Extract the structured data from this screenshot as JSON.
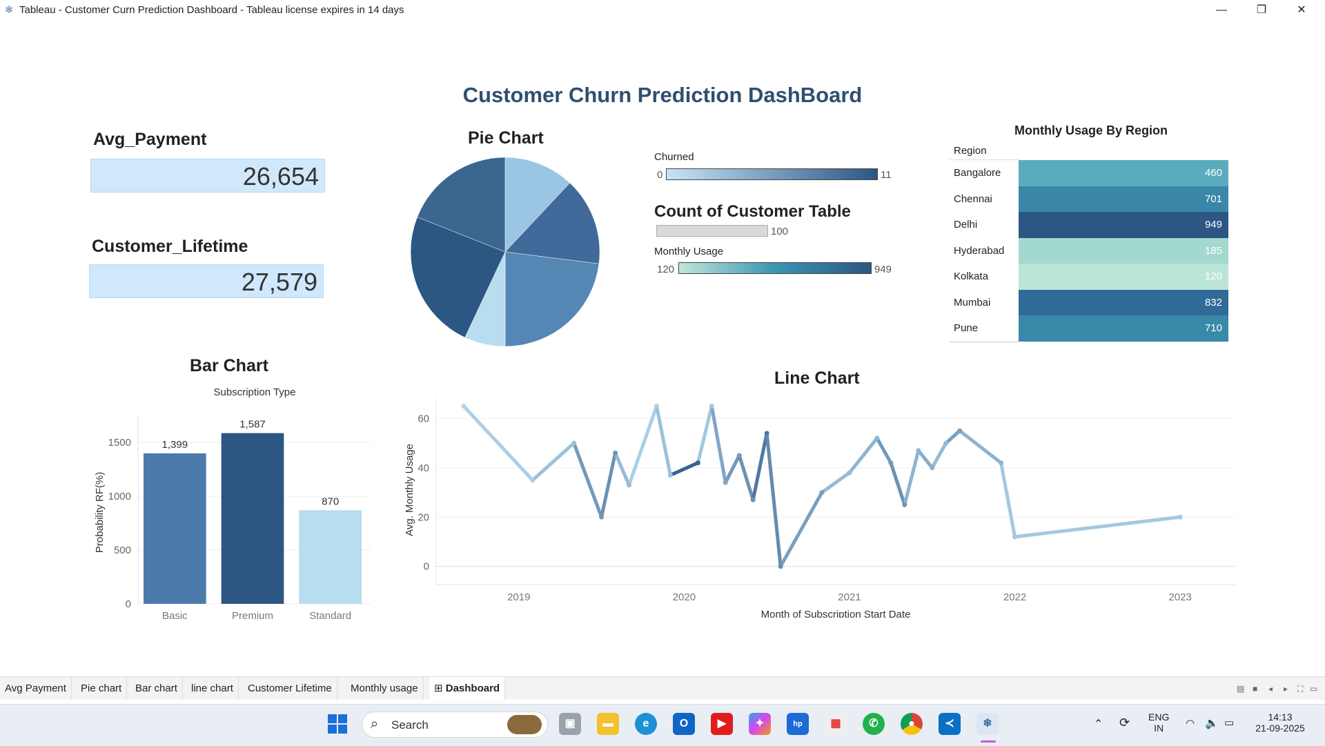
{
  "window": {
    "title": "Tableau - Customer Curn Prediction Dashboard - Tableau license expires in 14 days",
    "minimize": "—",
    "maximize": "❐",
    "close": "✕"
  },
  "dashboard": {
    "title": "Customer Churn Prediction DashBoard",
    "avg_payment": {
      "title": "Avg_Payment",
      "value": "26,654"
    },
    "customer_lifetime": {
      "title": "Customer_Lifetime",
      "value": "27,579"
    },
    "pie_title": "Pie Chart",
    "legends": {
      "churned": {
        "label": "Churned",
        "min": "0",
        "max": "11"
      },
      "count_title": "Count of Customer Table",
      "count": {
        "max": "100"
      },
      "monthly": {
        "label": "Monthly Usage",
        "min": "120",
        "max": "949"
      }
    },
    "region_title": "Monthly Usage By Region",
    "region_header": "Region",
    "bar_title": "Bar Chart",
    "line_title": "Line Chart"
  },
  "chart_data": [
    {
      "type": "pie",
      "title": "Pie Chart",
      "slices": [
        {
          "value": 12,
          "color": "#9ac6e3"
        },
        {
          "value": 15,
          "color": "#41699a"
        },
        {
          "value": 23,
          "color": "#5587b4"
        },
        {
          "value": 7,
          "color": "#b8dcf0"
        },
        {
          "value": 24,
          "color": "#2b5782"
        },
        {
          "value": 19,
          "color": "#3a6690"
        }
      ]
    },
    {
      "type": "table",
      "title": "Monthly Usage By Region",
      "header": "Region",
      "rows": [
        {
          "region": "Bangalore",
          "value": 460,
          "color": "#5aabbe"
        },
        {
          "region": "Chennai",
          "value": 701,
          "color": "#3a87a9"
        },
        {
          "region": "Delhi",
          "value": 949,
          "color": "#2c5684"
        },
        {
          "region": "Hyderabad",
          "value": 185,
          "color": "#a3d8cf"
        },
        {
          "region": "Kolkata",
          "value": 120,
          "color": "#bbe5d8"
        },
        {
          "region": "Mumbai",
          "value": 832,
          "color": "#306b98"
        },
        {
          "region": "Pune",
          "value": 710,
          "color": "#3989a9"
        }
      ]
    },
    {
      "type": "bar",
      "title": "Bar Chart",
      "column_header": "Subscription Type",
      "ylabel": "Probability RF(%)",
      "ylim": [
        0,
        1700
      ],
      "yticks": [
        0,
        500,
        1000,
        1500
      ],
      "categories": [
        "Basic",
        "Premium",
        "Standard"
      ],
      "values": [
        1399,
        1587,
        870
      ],
      "value_labels": [
        "1,399",
        "1,587",
        "870"
      ],
      "colors": [
        "#4c7bab",
        "#2b5782",
        "#b8dcf0"
      ]
    },
    {
      "type": "line",
      "title": "Line Chart",
      "xlabel": "Month of Subscription Start Date",
      "ylabel": "Avg. Monthly Usage",
      "ylim": [
        -4,
        66
      ],
      "yticks": [
        0,
        20,
        40,
        60
      ],
      "xticks": [
        "2019",
        "2020",
        "2021",
        "2022",
        "2023"
      ],
      "points": [
        {
          "x": "2018-09",
          "y": 65,
          "c": 0.05
        },
        {
          "x": "2019-02",
          "y": 35,
          "c": 0.1
        },
        {
          "x": "2019-05",
          "y": 50,
          "c": 0.2
        },
        {
          "x": "2019-07",
          "y": 20,
          "c": 0.5
        },
        {
          "x": "2019-08",
          "y": 46,
          "c": 0.55
        },
        {
          "x": "2019-09",
          "y": 33,
          "c": 0.25
        },
        {
          "x": "2019-11",
          "y": 65,
          "c": 0.1
        },
        {
          "x": "2019-12",
          "y": 37,
          "c": 0.2
        },
        {
          "x": "2020-02",
          "y": 42,
          "c": 0.9
        },
        {
          "x": "2020-03",
          "y": 65,
          "c": 0.15
        },
        {
          "x": "2020-04",
          "y": 34,
          "c": 0.4
        },
        {
          "x": "2020-05",
          "y": 45,
          "c": 0.5
        },
        {
          "x": "2020-06",
          "y": 27,
          "c": 0.55
        },
        {
          "x": "2020-07",
          "y": 54,
          "c": 0.75
        },
        {
          "x": "2020-08",
          "y": 0,
          "c": 0.6
        },
        {
          "x": "2020-11",
          "y": 30,
          "c": 0.45
        },
        {
          "x": "2021-01",
          "y": 38,
          "c": 0.25
        },
        {
          "x": "2021-03",
          "y": 52,
          "c": 0.3
        },
        {
          "x": "2021-04",
          "y": 42,
          "c": 0.5
        },
        {
          "x": "2021-05",
          "y": 25,
          "c": 0.55
        },
        {
          "x": "2021-06",
          "y": 47,
          "c": 0.3
        },
        {
          "x": "2021-07",
          "y": 40,
          "c": 0.35
        },
        {
          "x": "2021-08",
          "y": 50,
          "c": 0.25
        },
        {
          "x": "2021-09",
          "y": 55,
          "c": 0.45
        },
        {
          "x": "2021-12",
          "y": 42,
          "c": 0.3
        },
        {
          "x": "2022-01",
          "y": 12,
          "c": 0.15
        },
        {
          "x": "2023-01",
          "y": 20,
          "c": 0.15
        }
      ]
    }
  ],
  "tabs": [
    "Avg Payment",
    "Pie chart",
    "Bar chart",
    "line chart",
    "Customer Lifetime",
    "Monthly usage",
    "Dashboard"
  ],
  "active_tab": "Dashboard",
  "taskbar": {
    "search_label": "Search",
    "language": "ENG",
    "region": "IN",
    "time": "14:13",
    "date": "21-09-2025",
    "icons": [
      "windows-start-icon",
      "search-icon",
      "task-view-icon",
      "file-explorer-icon",
      "edge-icon",
      "outlook-icon",
      "youtube-icon",
      "copilot-icon",
      "myhp-icon",
      "microsoft-store-icon",
      "whatsapp-icon",
      "chrome-icon",
      "vscode-icon",
      "tableau-icon"
    ]
  }
}
